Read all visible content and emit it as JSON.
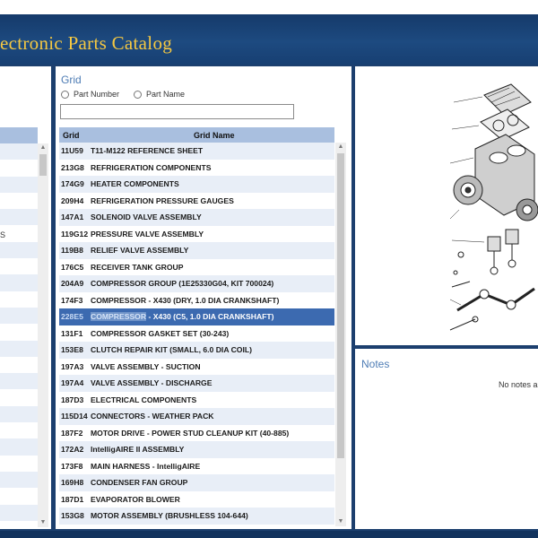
{
  "app": {
    "title": "ectronic Parts Catalog"
  },
  "colors": {
    "header_bg": "#1d4a80",
    "title_color": "#f5c842",
    "table_header": "#a9bfdf",
    "row_alt": "#e8eef7",
    "selected_row": "#3c6ab0",
    "accent_text": "#4f7db5"
  },
  "left_panel": {
    "stub_text": "S"
  },
  "grid_panel": {
    "title": "Grid",
    "search_options": [
      {
        "label": "Part Number",
        "selected": false
      },
      {
        "label": "Part Name",
        "selected": false
      }
    ],
    "search": {
      "value": "",
      "placeholder": ""
    },
    "columns": [
      "Grid",
      "Grid Name"
    ],
    "rows": [
      {
        "id": "11U59",
        "name": "T11-M122 REFERENCE SHEET"
      },
      {
        "id": "213G8",
        "name": "REFRIGERATION COMPONENTS"
      },
      {
        "id": "174G9",
        "name": "HEATER COMPONENTS"
      },
      {
        "id": "209H4",
        "name": "REFRIGERATION PRESSURE GAUGES"
      },
      {
        "id": "147A1",
        "name": "SOLENOID VALVE ASSEMBLY"
      },
      {
        "id": "119G12",
        "name": "PRESSURE VALVE ASSEMBLY"
      },
      {
        "id": "119B8",
        "name": "RELIEF VALVE ASSEMBLY"
      },
      {
        "id": "176C5",
        "name": "RECEIVER TANK GROUP"
      },
      {
        "id": "204A9",
        "name": "COMPRESSOR GROUP (1E25330G04, KIT 700024)"
      },
      {
        "id": "174F3",
        "name": "COMPRESSOR - X430 (DRY, 1.0 DIA CRANKSHAFT)"
      },
      {
        "id": "228E5",
        "name": "COMPRESSOR - X430 (C5, 1.0 DIA CRANKSHAFT)",
        "highlight": "COMPRESSOR",
        "rest": " - X430 (C5, 1.0 DIA CRANKSHAFT)",
        "selected": true
      },
      {
        "id": "131F1",
        "name": "COMPRESSOR GASKET SET (30-243)"
      },
      {
        "id": "153E8",
        "name": "CLUTCH REPAIR KIT (SMALL, 6.0 DIA COIL)"
      },
      {
        "id": "197A3",
        "name": "VALVE ASSEMBLY - SUCTION"
      },
      {
        "id": "197A4",
        "name": "VALVE ASSEMBLY - DISCHARGE"
      },
      {
        "id": "187D3",
        "name": "ELECTRICAL COMPONENTS"
      },
      {
        "id": "115D14",
        "name": "CONNECTORS - WEATHER PACK"
      },
      {
        "id": "187F2",
        "name": "MOTOR DRIVE - POWER STUD CLEANUP KIT (40-885)"
      },
      {
        "id": "172A2",
        "name": "IntelligAIRE II ASSEMBLY"
      },
      {
        "id": "173F8",
        "name": "MAIN HARNESS - IntelligAIRE"
      },
      {
        "id": "169H8",
        "name": "CONDENSER FAN GROUP"
      },
      {
        "id": "187D1",
        "name": "EVAPORATOR BLOWER"
      },
      {
        "id": "153G8",
        "name": "MOTOR ASSEMBLY (BRUSHLESS 104-644)"
      }
    ]
  },
  "notes": {
    "title": "Notes",
    "empty_text": "No notes a"
  },
  "icons": {
    "scroll_up": "triangle-up",
    "scroll_down": "triangle-down",
    "radio": "radio-circle"
  }
}
